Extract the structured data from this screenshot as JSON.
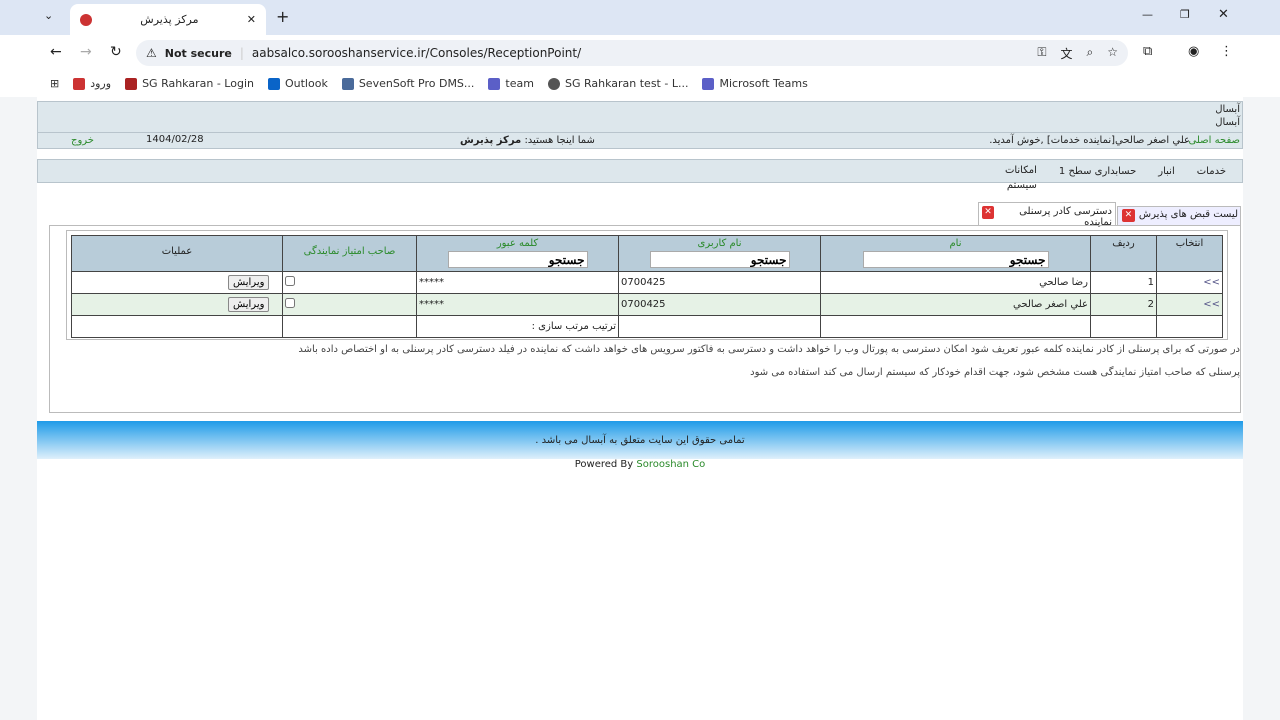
{
  "browser": {
    "tab_title": "مرکز پذیرش",
    "not_secure": "Not secure",
    "url": "aabsalco.sorooshanservice.ir/Consoles/ReceptionPoint/",
    "bookmarks": [
      "ورود",
      "SG Rahkaran - Login",
      "Outlook",
      "SevenSoft Pro DMS...",
      "team",
      "SG Rahkaran test - L...",
      "Microsoft Teams"
    ]
  },
  "header": {
    "site1": "آبسال",
    "site2": "آبسال",
    "home": "صفحه اصلی",
    "welcome": "علي اصغر صالحي[نماينده خدمات] ,خوش آمديد.",
    "you_are_here": "شما اینجا هستید:",
    "location": "مرکز پذیرش",
    "date": "1404/02/28",
    "logout": "خروج"
  },
  "menu": [
    "خدمات",
    "انبار",
    "حسابداری سطح 1",
    "امکانات سیستم"
  ],
  "tabs": [
    "ليست قبض های پذيرش",
    "دسترسی کادر پرسنلی نماینده"
  ],
  "table": {
    "headers": {
      "select": "انتخاب",
      "row": "ردیف",
      "name": "نام",
      "username": "نام کاربری",
      "password": "کلمه عبور",
      "owner": "صاحب امتیاز نمایندگی",
      "ops": "عملیات"
    },
    "search": "جستجو",
    "rows": [
      {
        "arrow": ">>",
        "num": "1",
        "name": "رضا صالحي",
        "username": "0700425",
        "password": "*****",
        "edit": "ويرايش"
      },
      {
        "arrow": ">>",
        "num": "2",
        "name": "علي اصغر صالحي",
        "username": "0700425",
        "password": "*****",
        "edit": "ويرايش"
      }
    ],
    "sort_label": "ترتیب مرتب سازی :"
  },
  "notes": [
    "در صورتی که برای پرسنلی از کادر نماینده کلمه عبور تعریف شود امکان دسترسی به پورتال وب را خواهد داشت و دسترسی به فاکتور سرویس های خواهد داشت که نماینده در فیلد دسترسی کادر پرسنلی به او اختصاص داده باشد",
    "پرسنلی که صاحب امتیاز نمایندگی هست مشخص شود، جهت اقدام خودکار که سیستم ارسال می کند استفاده می شود"
  ],
  "footer": {
    "rights": "تمامی حقوق این سایت متعلق به آبسال می باشد .",
    "powered": "Powered By",
    "company": "Sorooshan Co"
  }
}
